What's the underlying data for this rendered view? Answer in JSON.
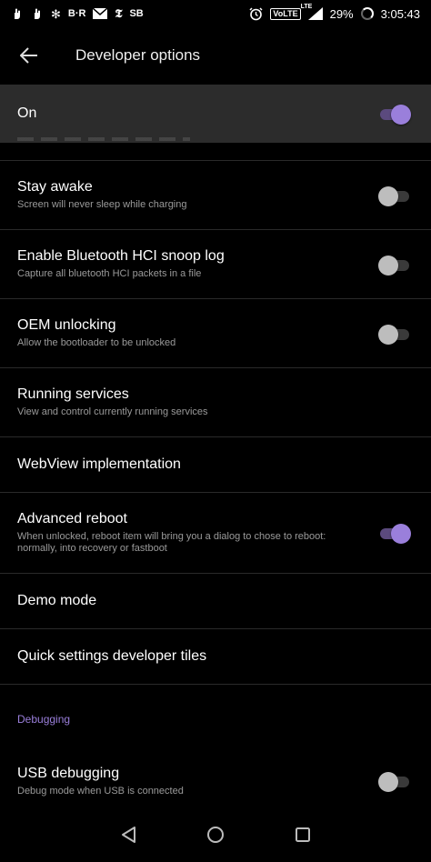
{
  "status_bar": {
    "left_icons": [
      "hand-icon",
      "hand-icon",
      "pinwheel-icon",
      "br-logo",
      "mail-icon",
      "nyt-icon",
      "sb-logo"
    ],
    "br_text": "B·R",
    "sb_text": "SB",
    "volte": "VoLTE",
    "lte": "LTE",
    "battery": "29%",
    "time": "3:05:43"
  },
  "app_bar": {
    "title": "Developer options"
  },
  "master_switch": {
    "label": "On",
    "checked": true
  },
  "settings": [
    {
      "title": "Stay awake",
      "subtitle": "Screen will never sleep while charging",
      "toggle": false
    },
    {
      "title": "Enable Bluetooth HCI snoop log",
      "subtitle": "Capture all bluetooth HCI packets in a file",
      "toggle": false
    },
    {
      "title": "OEM unlocking",
      "subtitle": "Allow the bootloader to be unlocked",
      "toggle": false
    },
    {
      "title": "Running services",
      "subtitle": "View and control currently running services"
    },
    {
      "title": "WebView implementation"
    },
    {
      "title": "Advanced reboot",
      "subtitle": "When unlocked, reboot item will bring you a dialog to chose to reboot: normally, into recovery or fastboot",
      "toggle": true
    },
    {
      "title": "Demo mode"
    },
    {
      "title": "Quick settings developer tiles"
    }
  ],
  "debugging": {
    "header": "Debugging",
    "usb": {
      "title": "USB debugging",
      "subtitle": "Debug mode when USB is connected",
      "toggle": false
    }
  },
  "colors": {
    "accent": "#9a7fdb",
    "background": "#000000",
    "master_bg": "#2c2c2c"
  }
}
